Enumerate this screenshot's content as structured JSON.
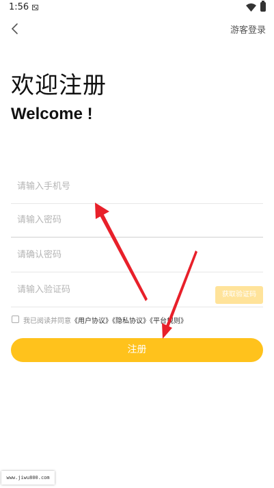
{
  "status_bar": {
    "time": "1:56"
  },
  "header": {
    "guest_login": "游客登录"
  },
  "titles": {
    "cn": "欢迎注册",
    "en": "Welcome !"
  },
  "form": {
    "phone_placeholder": "请输入手机号",
    "password_placeholder": "请输入密码",
    "confirm_password_placeholder": "请确认密码",
    "code_placeholder": "请输入验证码",
    "get_code_label": "获取验证码"
  },
  "agreement": {
    "prefix": "我已阅读并同意",
    "user_agreement": "《用户协议》",
    "privacy_agreement": "《隐私协议》",
    "platform_rules": "《平台规则》"
  },
  "register_label": "注册",
  "watermark": "www.jiwu800.com",
  "colors": {
    "accent": "#ffc21c",
    "accent_disabled": "#ffe39a",
    "arrow": "#e8202a"
  }
}
